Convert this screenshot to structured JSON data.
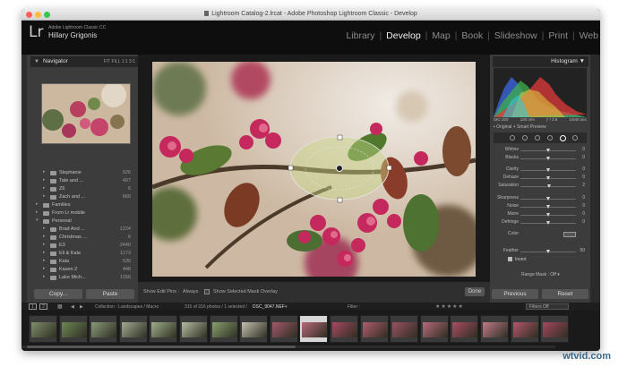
{
  "window": {
    "title": "Lightroom Catalog-2.lrcat - Adobe Photoshop Lightroom Classic - Develop"
  },
  "identity": {
    "logo": "Lr",
    "app_name": "Adobe Lightroom Classic CC",
    "user": "Hillary Grigonis"
  },
  "modules": [
    "Library",
    "Develop",
    "Map",
    "Book",
    "Slideshow",
    "Print",
    "Web"
  ],
  "active_module": "Develop",
  "navigator": {
    "title": "Navigator",
    "options": [
      "FIT",
      "FILL",
      "1:1",
      "3:1"
    ]
  },
  "folders": [
    {
      "name": "Stephanie",
      "count": "926",
      "type": "folder"
    },
    {
      "name": "Tate and ...",
      "count": "497",
      "type": "folder"
    },
    {
      "name": "Z6",
      "count": "6",
      "type": "folder"
    },
    {
      "name": "Zach and ...",
      "count": "669",
      "type": "folder"
    },
    {
      "name": "Families",
      "count": "",
      "type": "collection-set"
    },
    {
      "name": "From Lr mobile",
      "count": "",
      "type": "collection-set"
    },
    {
      "name": "Personal",
      "count": "",
      "type": "collection-set"
    },
    {
      "name": "Brad And ...",
      "count": "1224",
      "type": "folder"
    },
    {
      "name": "Christmas ...",
      "count": "6",
      "type": "folder"
    },
    {
      "name": "E3",
      "count": "2440",
      "type": "folder"
    },
    {
      "name": "Eli & Kala",
      "count": "1173",
      "type": "folder"
    },
    {
      "name": "Kala",
      "count": "539",
      "type": "folder"
    },
    {
      "name": "Kasen 2",
      "count": "448",
      "type": "folder"
    },
    {
      "name": "Lake Mich...",
      "count": "1156",
      "type": "folder"
    }
  ],
  "left_buttons": {
    "copy": "Copy...",
    "paste": "Paste"
  },
  "toolbar": {
    "show_edit_pins_label": "Show Edit Pins :",
    "show_edit_pins_value": "Always",
    "mask_overlay_label": "Show Selected Mask Overlay",
    "done": "Done"
  },
  "histogram": {
    "title": "Histogram",
    "iso": "ISO 200",
    "focal": "100 mm",
    "aperture": "ƒ / 2.8",
    "shutter": "1/640 sec",
    "preview_label": "Original + Smart Preview"
  },
  "sliders": [
    {
      "label": "Whites",
      "value": "0",
      "pos": 0.5
    },
    {
      "label": "Blacks",
      "value": "0",
      "pos": 0.5
    },
    {
      "label": "Clarity",
      "value": "0",
      "pos": 0.5
    },
    {
      "label": "Dehaze",
      "value": "0",
      "pos": 0.5
    },
    {
      "label": "Saturation",
      "value": "2",
      "pos": 0.52
    },
    {
      "label": "Sharpness",
      "value": "0",
      "pos": 0.5
    },
    {
      "label": "Noise",
      "value": "0",
      "pos": 0.5
    },
    {
      "label": "Moire",
      "value": "0",
      "pos": 0.5
    },
    {
      "label": "Defringe",
      "value": "0",
      "pos": 0.5
    },
    {
      "label": "Color",
      "value": "",
      "pos": 0.5
    },
    {
      "label": "Feather",
      "value": "50",
      "pos": 0.5
    }
  ],
  "invert_label": "Invert",
  "range_mask": {
    "label": "Range Mask :",
    "value": "Off"
  },
  "right_buttons": {
    "previous": "Previous",
    "reset": "Reset"
  },
  "filmstrip": {
    "pages": [
      "1",
      "2"
    ],
    "collection": "Collection : Landscapes / Macro",
    "count": "315 of 316 photos / 1 selected /",
    "filename": "DSC_9047.NEF",
    "filter_label": "Filter :",
    "filters_off": "Filters Off",
    "selected_index": 9,
    "thumbs": [
      "#7f8f6a",
      "#6f8756",
      "#8a9a7a",
      "#a0aa92",
      "#9fae8a",
      "#b3bca0",
      "#89a06c",
      "#c4bfae",
      "#a2586b",
      "#b8687a",
      "#a54a62",
      "#b15c6f",
      "#9a5263",
      "#b76a7c",
      "#a94d64",
      "#c07b8a",
      "#b2566b",
      "#a4485f"
    ]
  },
  "watermark": "wtvid.com",
  "colors": {
    "accent_mask": "#c9d88a",
    "panel": "#3c3c3c",
    "dark": "#1a1a1a"
  }
}
